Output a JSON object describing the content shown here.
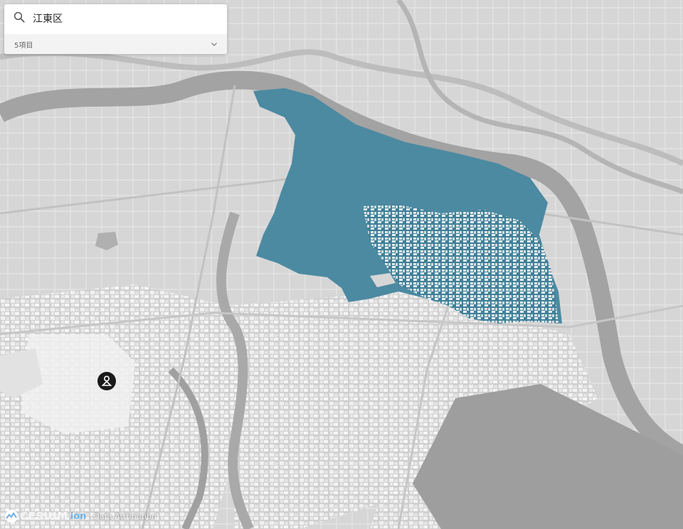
{
  "search": {
    "query": "江東区",
    "results_summary": "5項目"
  },
  "map": {
    "highlight_color": "#4c8aa2",
    "base_color": "#d4d4d4",
    "water_color": "#9e9e9e"
  },
  "footer": {
    "logo_text": "CESIUM",
    "logo_suffix": "ion",
    "attribution_label": "Data Attribution"
  },
  "icons": [
    "search-icon",
    "chevron-down-icon",
    "location-marker-icon",
    "cesium-logo-icon"
  ]
}
